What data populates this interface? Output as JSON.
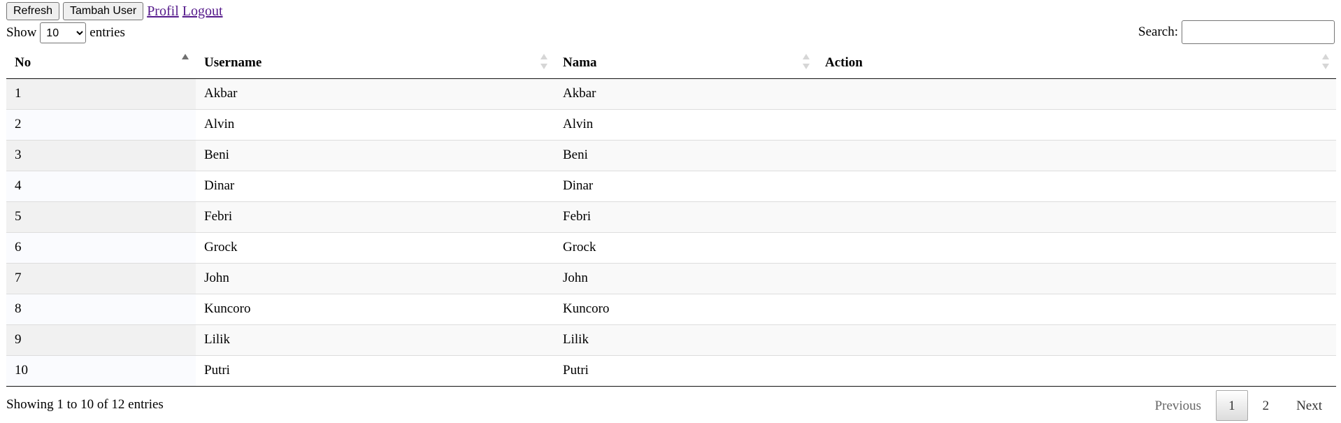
{
  "toolbar": {
    "refresh_label": "Refresh",
    "add_user_label": "Tambah User",
    "profil_label": "Profil",
    "logout_label": "Logout"
  },
  "length_menu": {
    "prefix": "Show",
    "selected": "10",
    "options": [
      "10"
    ],
    "suffix": "entries"
  },
  "search": {
    "label": "Search:",
    "value": "",
    "placeholder": ""
  },
  "table": {
    "columns": [
      "No",
      "Username",
      "Nama",
      "Action"
    ],
    "sorted_column": "No",
    "sort_direction": "ascending",
    "rows": [
      {
        "no": "1",
        "username": "Akbar",
        "nama": "Akbar",
        "action": ""
      },
      {
        "no": "2",
        "username": "Alvin",
        "nama": "Alvin",
        "action": ""
      },
      {
        "no": "3",
        "username": "Beni",
        "nama": "Beni",
        "action": ""
      },
      {
        "no": "4",
        "username": "Dinar",
        "nama": "Dinar",
        "action": ""
      },
      {
        "no": "5",
        "username": "Febri",
        "nama": "Febri",
        "action": ""
      },
      {
        "no": "6",
        "username": "Grock",
        "nama": "Grock",
        "action": ""
      },
      {
        "no": "7",
        "username": "John",
        "nama": "John",
        "action": ""
      },
      {
        "no": "8",
        "username": "Kuncoro",
        "nama": "Kuncoro",
        "action": ""
      },
      {
        "no": "9",
        "username": "Lilik",
        "nama": "Lilik",
        "action": ""
      },
      {
        "no": "10",
        "username": "Putri",
        "nama": "Putri",
        "action": ""
      }
    ]
  },
  "info": {
    "text": "Showing 1 to 10 of 12 entries"
  },
  "pagination": {
    "previous_label": "Previous",
    "pages": [
      "1",
      "2"
    ],
    "current_page": "1",
    "next_label": "Next"
  },
  "colors": {
    "link_visited": "#551a8b",
    "row_odd": "#f9f9f9",
    "row_odd_sorted": "#f1f1f1",
    "row_even_sorted": "#fafbfe"
  }
}
